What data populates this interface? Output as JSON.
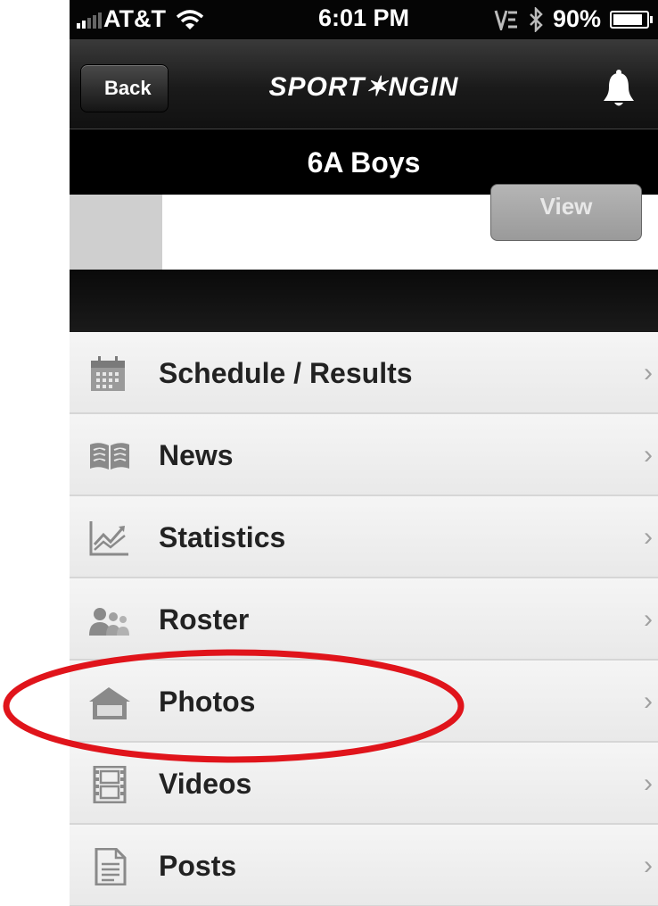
{
  "status_bar": {
    "carrier": "AT&T",
    "time": "6:01 PM",
    "battery": "90%",
    "battery_level": 0.9
  },
  "nav": {
    "back_label": "Back",
    "logo_text": "SPORT✶NGIN",
    "bell_icon": "bell-icon"
  },
  "title": "6A Boys",
  "card": {
    "view_label": "View"
  },
  "menu": {
    "items": [
      {
        "label": "Schedule / Results",
        "icon": "calendar-icon"
      },
      {
        "label": "News",
        "icon": "book-icon"
      },
      {
        "label": "Statistics",
        "icon": "chart-icon"
      },
      {
        "label": "Roster",
        "icon": "people-icon"
      },
      {
        "label": "Photos",
        "icon": "photo-icon"
      },
      {
        "label": "Videos",
        "icon": "film-icon"
      },
      {
        "label": "Posts",
        "icon": "document-icon"
      }
    ],
    "chevron": "›"
  },
  "colors": {
    "highlight_oval": "#e0141b",
    "nav_background": "#1a1a1a",
    "row_text": "#222222"
  }
}
